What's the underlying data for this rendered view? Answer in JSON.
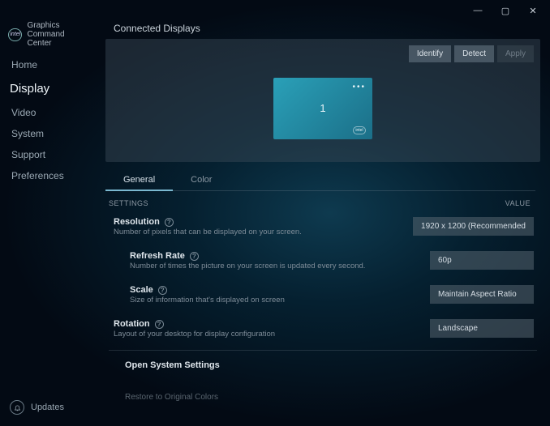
{
  "app_title": "Graphics Command Center",
  "brand": "intel",
  "window": {
    "min": "—",
    "max": "▢",
    "close": "✕"
  },
  "nav": {
    "items": [
      {
        "label": "Home"
      },
      {
        "label": "Display"
      },
      {
        "label": "Video"
      },
      {
        "label": "System"
      },
      {
        "label": "Support"
      },
      {
        "label": "Preferences"
      }
    ],
    "active_index": 1
  },
  "updates_label": "Updates",
  "connected_displays": {
    "title": "Connected Displays",
    "buttons": {
      "identify": "Identify",
      "detect": "Detect",
      "apply": "Apply"
    },
    "display_number": "1"
  },
  "tabs": {
    "items": [
      {
        "label": "General"
      },
      {
        "label": "Color"
      }
    ],
    "active_index": 0
  },
  "settings_header": {
    "left": "SETTINGS",
    "right": "VALUE"
  },
  "settings": [
    {
      "label": "Resolution",
      "desc": "Number of pixels that can be displayed on your screen.",
      "value": "1920 x 1200 (Recommended",
      "indent": false
    },
    {
      "label": "Refresh Rate",
      "desc": "Number of times the picture on your screen is updated every second.",
      "value": "60p",
      "indent": true
    },
    {
      "label": "Scale",
      "desc": "Size of information that's displayed on screen",
      "value": "Maintain Aspect Ratio",
      "indent": true
    },
    {
      "label": "Rotation",
      "desc": "Layout of your desktop for display configuration",
      "value": "Landscape",
      "indent": false
    }
  ],
  "open_system_settings": "Open System Settings",
  "restore_colors": "Restore to Original Colors"
}
